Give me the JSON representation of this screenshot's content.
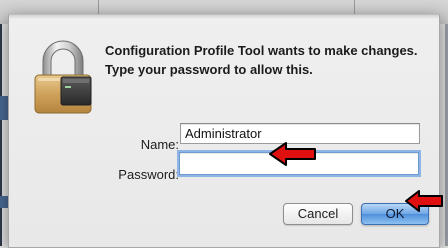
{
  "dialog": {
    "message": "Configuration Profile Tool wants to make changes. Type your password to allow this.",
    "name_label": "Name:",
    "name_value": "Administrator",
    "password_label": "Password:",
    "password_value": "",
    "cancel_label": "Cancel",
    "ok_label": "OK"
  },
  "icons": {
    "lock": "lock-icon",
    "annotation_arrow": "red-arrow-icon"
  },
  "colors": {
    "default_button": "#5c97df",
    "focus_ring": "#8fb5e6",
    "annotation_arrow": "#e01010"
  }
}
